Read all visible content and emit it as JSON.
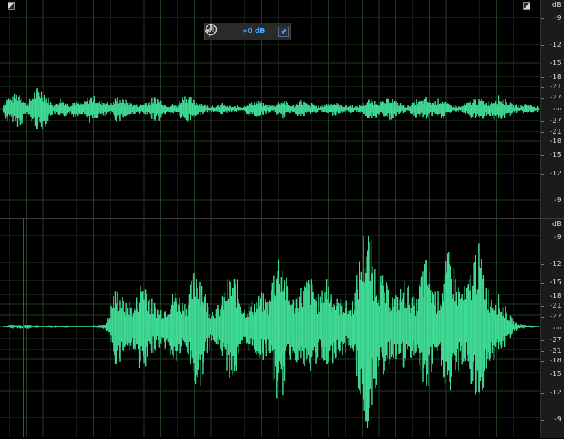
{
  "theme": {
    "waveform": "#3fd994",
    "grid": "#1f3a21",
    "centerline": "#4a4a4a",
    "playhead": "#c01a1a",
    "accent": "#4aa9ff"
  },
  "hud": {
    "bars_icon": "signal-bars-icon",
    "power_icon": "power-icon",
    "gain_label": "+0 dB",
    "pin_icon": "pin-icon"
  },
  "db_scale": {
    "unit": "dB",
    "tick_labels": [
      "-9",
      "-12",
      "-15",
      "-18",
      "-21",
      "-27",
      "-∞",
      "-27",
      "-21",
      "-18",
      "-15",
      "-12",
      "-9"
    ],
    "tick_levels": [
      -9,
      -12,
      -15,
      -18,
      -21,
      -27,
      null,
      -27,
      -21,
      -18,
      -15,
      -12,
      -9
    ]
  },
  "channels": [
    {
      "name": "top-channel",
      "envelope": [
        0.06,
        0.16,
        0.13,
        0.2,
        0.22,
        0.07,
        0.1,
        0.21,
        0.26,
        0.24,
        0.17,
        0.08,
        0.06,
        0.14,
        0.11,
        0.05,
        0.1,
        0.09,
        0.06,
        0.11,
        0.16,
        0.15,
        0.09,
        0.11,
        0.08,
        0.06,
        0.15,
        0.13,
        0.11,
        0.09,
        0.06,
        0.05,
        0.07,
        0.09,
        0.12,
        0.15,
        0.13,
        0.07,
        0.05,
        0.06,
        0.04,
        0.16,
        0.18,
        0.14,
        0.1,
        0.08,
        0.06,
        0.04,
        0.05,
        0.03,
        0.07,
        0.05,
        0.04,
        0.03,
        0.04,
        0.03,
        0.08,
        0.09,
        0.1,
        0.09,
        0.06,
        0.05,
        0.04,
        0.08,
        0.12,
        0.09,
        0.04,
        0.05,
        0.11,
        0.1,
        0.05,
        0.07,
        0.04,
        0.03,
        0.06,
        0.07,
        0.08,
        0.06,
        0.05,
        0.04,
        0.05,
        0.03,
        0.05,
        0.08,
        0.12,
        0.11,
        0.1,
        0.08,
        0.12,
        0.15,
        0.09,
        0.07,
        0.05,
        0.04,
        0.08,
        0.12,
        0.1,
        0.14,
        0.1,
        0.09,
        0.13,
        0.11,
        0.06,
        0.05,
        0.04,
        0.03,
        0.06,
        0.09,
        0.13,
        0.11,
        0.12,
        0.08,
        0.1,
        0.14,
        0.16,
        0.12,
        0.09,
        0.05,
        0.05,
        0.04,
        0.07,
        0.05,
        0.04,
        0.03
      ]
    },
    {
      "name": "bottom-channel",
      "envelope": [
        0.0,
        0.01,
        0.02,
        0.01,
        0.02,
        0.01,
        0.03,
        0.01,
        0.01,
        0.01,
        0.0,
        0.01,
        0.01,
        0.01,
        0.01,
        0.01,
        0.01,
        0.0,
        0.0,
        0.0,
        0.0,
        0.0,
        0.01,
        0.01,
        0.02,
        0.03,
        0.14,
        0.34,
        0.36,
        0.3,
        0.22,
        0.26,
        0.2,
        0.33,
        0.5,
        0.46,
        0.28,
        0.24,
        0.2,
        0.18,
        0.22,
        0.3,
        0.36,
        0.32,
        0.24,
        0.26,
        0.44,
        0.6,
        0.62,
        0.4,
        0.24,
        0.18,
        0.2,
        0.22,
        0.34,
        0.46,
        0.5,
        0.48,
        0.3,
        0.2,
        0.22,
        0.26,
        0.28,
        0.32,
        0.3,
        0.24,
        0.56,
        0.72,
        0.74,
        0.5,
        0.32,
        0.28,
        0.36,
        0.4,
        0.46,
        0.48,
        0.4,
        0.3,
        0.34,
        0.52,
        0.4,
        0.3,
        0.26,
        0.28,
        0.24,
        0.2,
        0.38,
        0.62,
        0.9,
        0.98,
        0.78,
        0.58,
        0.52,
        0.46,
        0.38,
        0.32,
        0.3,
        0.36,
        0.44,
        0.4,
        0.3,
        0.26,
        0.5,
        0.66,
        0.6,
        0.42,
        0.32,
        0.36,
        0.58,
        0.72,
        0.62,
        0.44,
        0.36,
        0.38,
        0.48,
        0.7,
        0.82,
        0.64,
        0.44,
        0.34,
        0.32,
        0.3,
        0.24,
        0.18,
        0.1,
        0.05,
        0.03,
        0.02,
        0.01,
        0.01,
        0.01,
        0.0
      ]
    }
  ]
}
